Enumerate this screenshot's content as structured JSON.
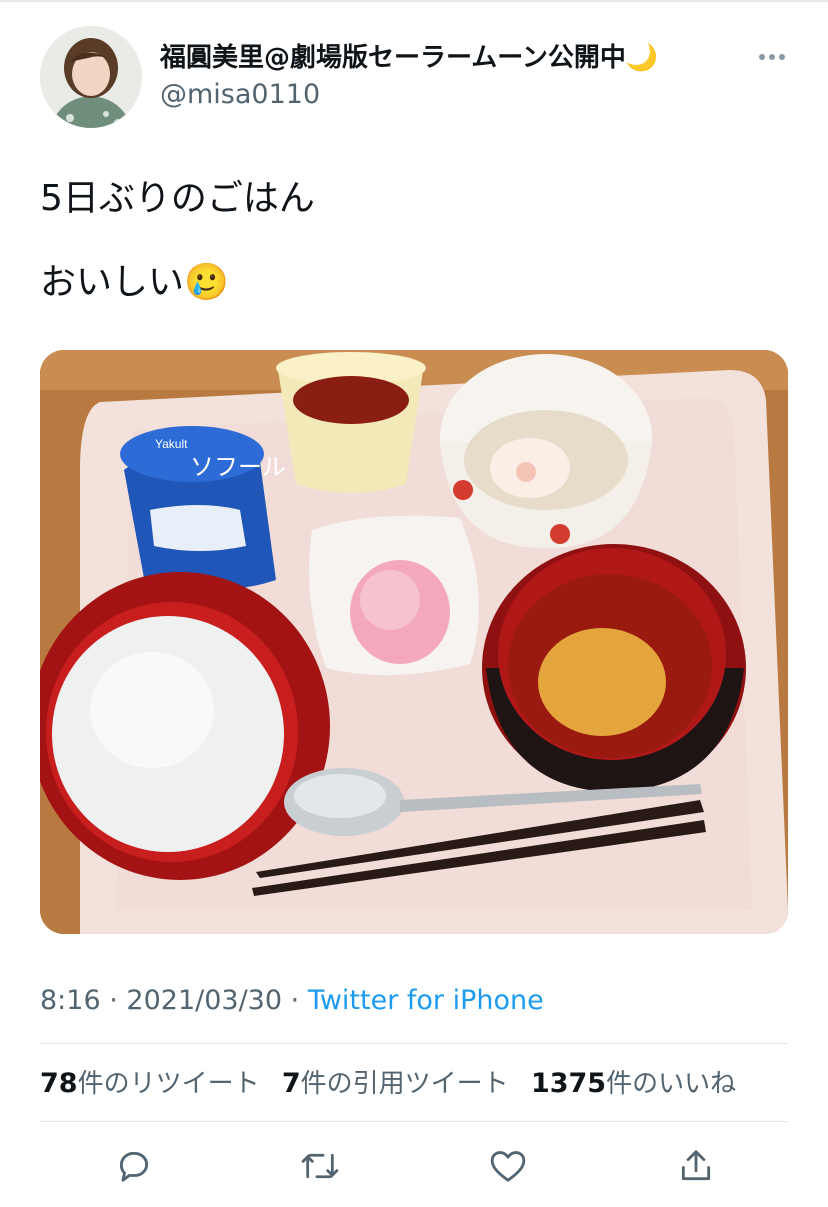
{
  "user": {
    "display_name": "福圓美里@劇場版セーラームーン公開中",
    "name_emoji": "🌙",
    "handle": "@misa0110"
  },
  "tweet": {
    "lines": [
      "5日ぶりのごはん",
      "おいしい"
    ],
    "line2_emoji": "🥲"
  },
  "meta": {
    "time": "8:16",
    "sep": "·",
    "date": "2021/03/30",
    "source": "Twitter for iPhone"
  },
  "stats": {
    "retweets": {
      "count": "78",
      "label": "件のリツイート"
    },
    "quotes": {
      "count": "7",
      "label": "件の引用ツイート"
    },
    "likes": {
      "count": "1375",
      "label": "件のいいね"
    }
  },
  "photo": {
    "yogurt_brand": "Yakult",
    "yogurt_name": "ソフール"
  },
  "colors": {
    "link": "#1d9bf0",
    "secondary_text": "#536471",
    "primary_text": "#0f1419",
    "divider": "#e1e6ea"
  },
  "icons": [
    "more-icon",
    "reply-icon",
    "retweet-icon",
    "like-icon",
    "share-icon"
  ]
}
